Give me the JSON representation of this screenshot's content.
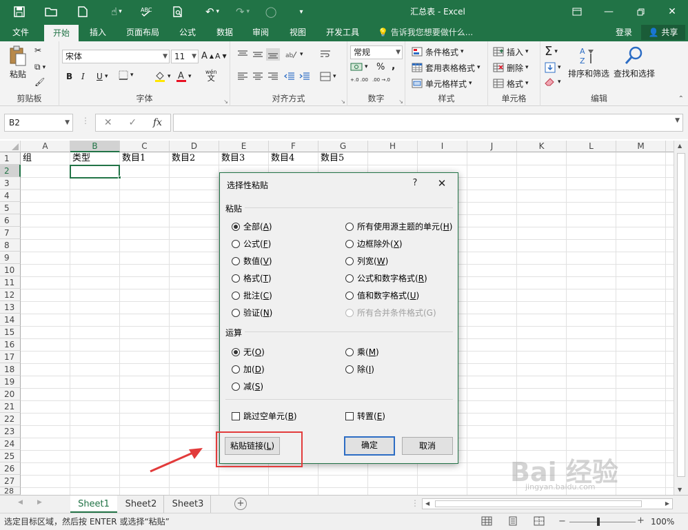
{
  "window": {
    "title": "汇总表 - Excel"
  },
  "menu": {
    "tabs": [
      "文件",
      "开始",
      "插入",
      "页面布局",
      "公式",
      "数据",
      "审阅",
      "视图",
      "开发工具"
    ],
    "active_tab": "开始",
    "tell_me": "告诉我您想要做什么...",
    "login": "登录",
    "share": "共享"
  },
  "ribbon": {
    "clipboard": {
      "label": "剪贴板",
      "paste": "粘贴"
    },
    "font": {
      "label": "字体",
      "name": "宋体",
      "size": "11",
      "bold": "B",
      "italic": "I",
      "underline": "U",
      "wen": "wén",
      "pinyin": "文"
    },
    "alignment": {
      "label": "对齐方式"
    },
    "number": {
      "label": "数字",
      "format": "常规",
      "percent": "%",
      "comma": ",",
      "inc_dec": "+.0 .00",
      "dec_dec": ".00 →.0"
    },
    "styles": {
      "label": "样式",
      "conditional": "条件格式",
      "table": "套用表格格式",
      "cell_styles": "单元格样式"
    },
    "cells": {
      "label": "单元格",
      "insert": "插入",
      "delete": "删除",
      "format": "格式"
    },
    "editing": {
      "label": "编辑",
      "sort": "排序和筛选",
      "find": "查找和选择",
      "sum": "Σ"
    }
  },
  "formula_bar": {
    "name_box": "B2",
    "cancel": "✕",
    "enter": "✓",
    "fx": "fx"
  },
  "grid": {
    "columns": [
      "A",
      "B",
      "C",
      "D",
      "E",
      "F",
      "G",
      "H",
      "I",
      "J",
      "K",
      "L",
      "M"
    ],
    "rows": [
      "1",
      "2",
      "3",
      "4",
      "5",
      "6",
      "7",
      "8",
      "9",
      "10",
      "11",
      "12",
      "13",
      "14",
      "15",
      "16",
      "17",
      "18",
      "19",
      "20",
      "21",
      "22",
      "23",
      "24",
      "25",
      "26",
      "27",
      "28"
    ],
    "row1": [
      "组",
      "类型",
      "数目1",
      "数目2",
      "数目3",
      "数目4",
      "数目5"
    ]
  },
  "sheets": [
    "Sheet1",
    "Sheet2",
    "Sheet3"
  ],
  "active_sheet": "Sheet1",
  "status": {
    "text": "选定目标区域，然后按 ENTER 或选择“粘贴”",
    "zoom": "100%"
  },
  "dialog": {
    "title": "选择性粘贴",
    "help": "?",
    "close": "✕",
    "paste_section": "粘贴",
    "paste_left": [
      {
        "text": "全部(",
        "key": "A",
        "end": ")",
        "checked": true
      },
      {
        "text": "公式(",
        "key": "F",
        "end": ")"
      },
      {
        "text": "数值(",
        "key": "V",
        "end": ")"
      },
      {
        "text": "格式(",
        "key": "T",
        "end": ")"
      },
      {
        "text": "批注(",
        "key": "C",
        "end": ")"
      },
      {
        "text": "验证(",
        "key": "N",
        "end": ")"
      }
    ],
    "paste_right": [
      {
        "text": "所有使用源主题的单元(",
        "key": "H",
        "end": ")"
      },
      {
        "text": "边框除外(",
        "key": "X",
        "end": ")"
      },
      {
        "text": "列宽(",
        "key": "W",
        "end": ")"
      },
      {
        "text": "公式和数字格式(",
        "key": "R",
        "end": ")"
      },
      {
        "text": "值和数字格式(",
        "key": "U",
        "end": ")"
      },
      {
        "text": "所有合并条件格式(G)",
        "key": "",
        "end": "",
        "disabled": true
      }
    ],
    "operation_section": "运算",
    "op_left": [
      {
        "text": "无(",
        "key": "O",
        "end": ")",
        "checked": true
      },
      {
        "text": "加(",
        "key": "D",
        "end": ")"
      },
      {
        "text": "减(",
        "key": "S",
        "end": ")"
      }
    ],
    "op_right": [
      {
        "text": "乘(",
        "key": "M",
        "end": ")"
      },
      {
        "text": "除(",
        "key": "I",
        "end": ")"
      }
    ],
    "skip_blanks": {
      "text": "跳过空单元(",
      "key": "B",
      "end": ")"
    },
    "transpose": {
      "text": "转置(",
      "key": "E",
      "end": ")"
    },
    "paste_link": {
      "text": "粘贴链接(",
      "key": "L",
      "end": ")"
    },
    "ok": "确定",
    "cancel": "取消"
  },
  "watermark": {
    "text": "Bai 经验",
    "sub": "jingyan.baidu.com"
  },
  "colors": {
    "excel_green": "#217346",
    "highlight": "#e23b3b",
    "arrow": "#e23b3b"
  }
}
